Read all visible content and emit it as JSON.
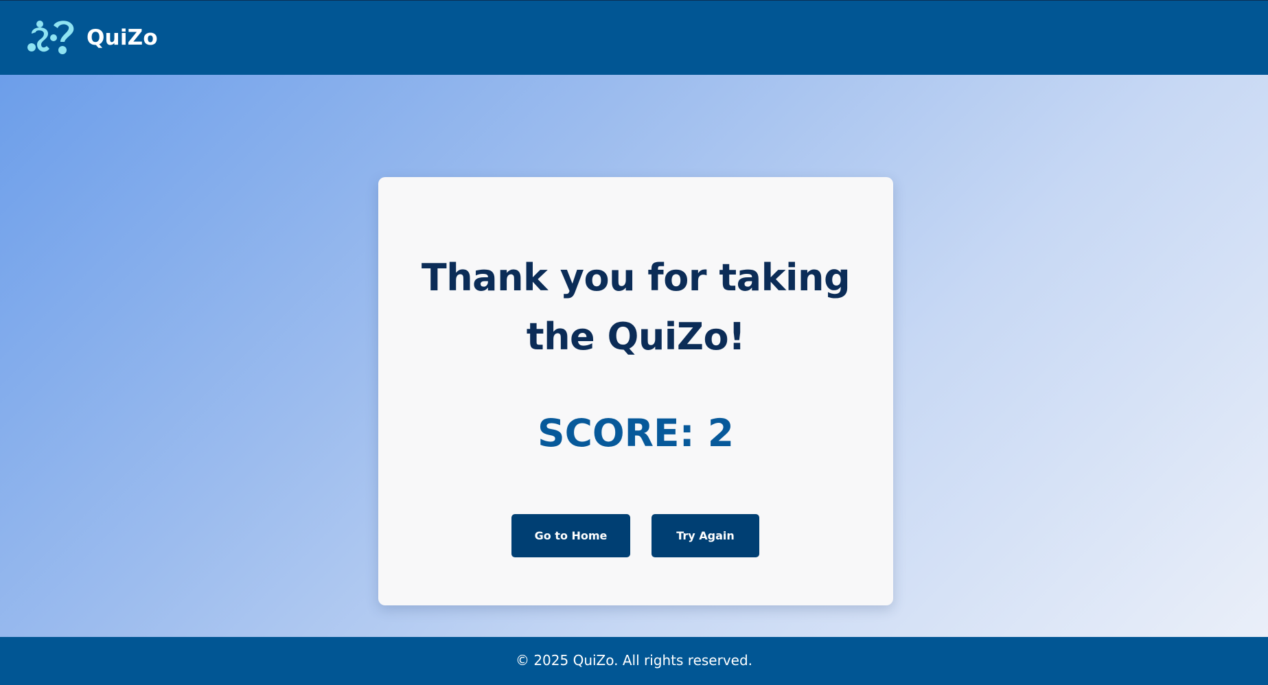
{
  "header": {
    "brand_name": "QuiZo",
    "logo_icon": "quizo-question-logo-icon"
  },
  "result": {
    "title_line1": "Thank you for taking",
    "title_line2": "the QuiZo!",
    "score_text": "SCORE: 2",
    "score_value": 2
  },
  "actions": {
    "home_label": "Go to Home",
    "retry_label": "Try Again"
  },
  "footer": {
    "copyright": "© 2025 QuiZo. All rights reserved."
  },
  "colors": {
    "header_bg": "#015694",
    "title": "#0b2c57",
    "score": "#07599a",
    "button_bg": "#003f73",
    "logo_accent": "#8fe3f2"
  }
}
